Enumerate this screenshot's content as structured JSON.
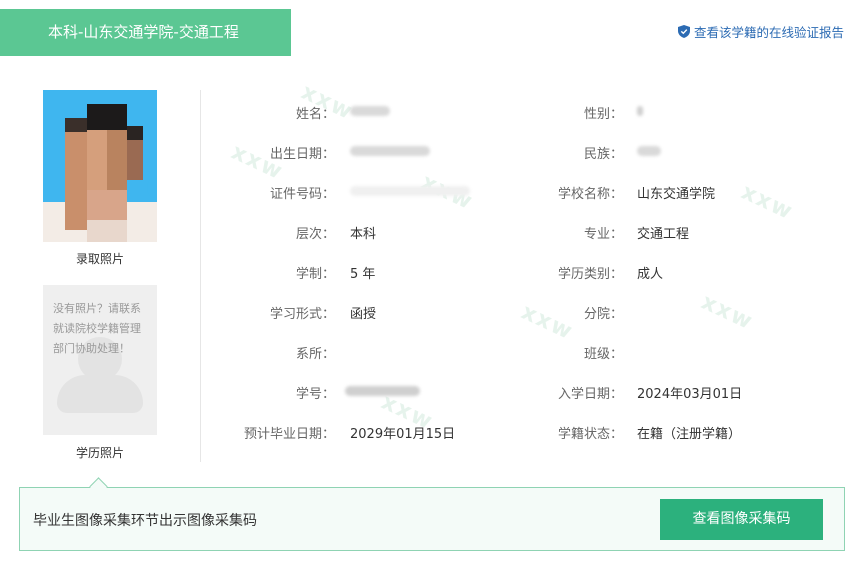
{
  "header": {
    "tab_title": "本科-山东交通学院-交通工程",
    "verify_link": "查看该学籍的在线验证报告",
    "accent_color": "#5bc793"
  },
  "photos": {
    "admission_label": "录取照片",
    "degree_label": "学历照片",
    "no_photo_message": "没有照片？请联系就读院校学籍管理部门协助处理！"
  },
  "fields_left": [
    {
      "label": "姓名：",
      "value": ""
    },
    {
      "label": "出生日期：",
      "value": ""
    },
    {
      "label": "证件号码：",
      "value": ""
    },
    {
      "label": "层次：",
      "value": "本科"
    },
    {
      "label": "学制：",
      "value": "5 年"
    },
    {
      "label": "学习形式：",
      "value": "函授"
    },
    {
      "label": "系所：",
      "value": ""
    },
    {
      "label": "学号：",
      "value": ""
    },
    {
      "label": "预计毕业日期：",
      "value": "2029年01月15日"
    }
  ],
  "fields_right": [
    {
      "label": "性别：",
      "value": ""
    },
    {
      "label": "民族：",
      "value": ""
    },
    {
      "label": "学校名称：",
      "value": "山东交通学院"
    },
    {
      "label": "专业：",
      "value": "交通工程"
    },
    {
      "label": "学历类别：",
      "value": "成人"
    },
    {
      "label": "分院：",
      "value": ""
    },
    {
      "label": "班级：",
      "value": ""
    },
    {
      "label": "入学日期：",
      "value": "2024年03月01日"
    },
    {
      "label": "学籍状态：",
      "value": "在籍（注册学籍）"
    }
  ],
  "footer": {
    "message": "毕业生图像采集环节出示图像采集码",
    "button_label": "查看图像采集码",
    "button_color": "#2cb17d"
  },
  "icons": {
    "verify": "shield-check-icon"
  }
}
